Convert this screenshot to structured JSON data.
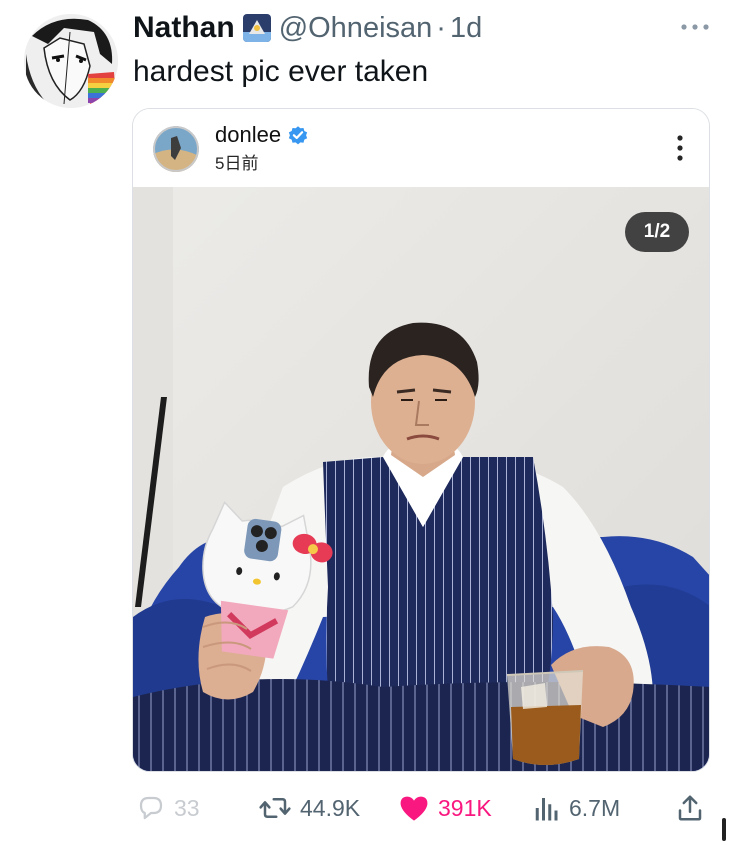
{
  "tweet": {
    "display_name": "Nathan",
    "handle": "@Ohneisan",
    "separator": "·",
    "time": "1d",
    "text": "hardest pic ever taken"
  },
  "embed": {
    "username": "donlee",
    "time": "5日前",
    "pager": "1/2"
  },
  "actions": {
    "replies": "33",
    "retweets": "44.9K",
    "likes": "391K",
    "views": "6.7M"
  },
  "colors": {
    "like": "#f91880",
    "muted": "#536471",
    "verified": "#3897f0"
  },
  "icons": {
    "more": "more-horizontal-icon",
    "reply": "reply-icon",
    "retweet": "retweet-icon",
    "like": "heart-icon",
    "views": "views-chart-icon",
    "share": "share-icon",
    "verified": "verified-badge-icon",
    "embed_menu": "more-vertical-icon"
  }
}
